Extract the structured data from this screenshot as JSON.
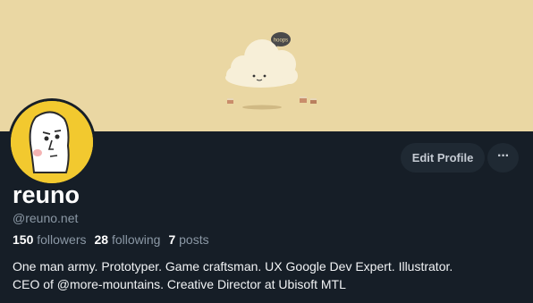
{
  "banner": {
    "bubble_text": "hoops",
    "background_color": "#ead7a3"
  },
  "profile": {
    "display_name": "reuno",
    "handle": "@reuno.net",
    "avatar_color": "#f2c92f",
    "stats": {
      "followers_count": "150",
      "followers_label": "followers",
      "following_count": "28",
      "following_label": "following",
      "posts_count": "7",
      "posts_label": "posts"
    },
    "bio_line1": "One man army. Prototyper. Game craftsman. UX Google Dev Expert. Illustrator.",
    "bio_line2": "CEO of @more-mountains. Creative Director at Ubisoft MTL"
  },
  "actions": {
    "edit_profile_label": "Edit Profile",
    "more_label": "···"
  },
  "colors": {
    "page_background": "#161e27",
    "button_background": "#1f2933",
    "muted_text": "#8b98a5"
  }
}
